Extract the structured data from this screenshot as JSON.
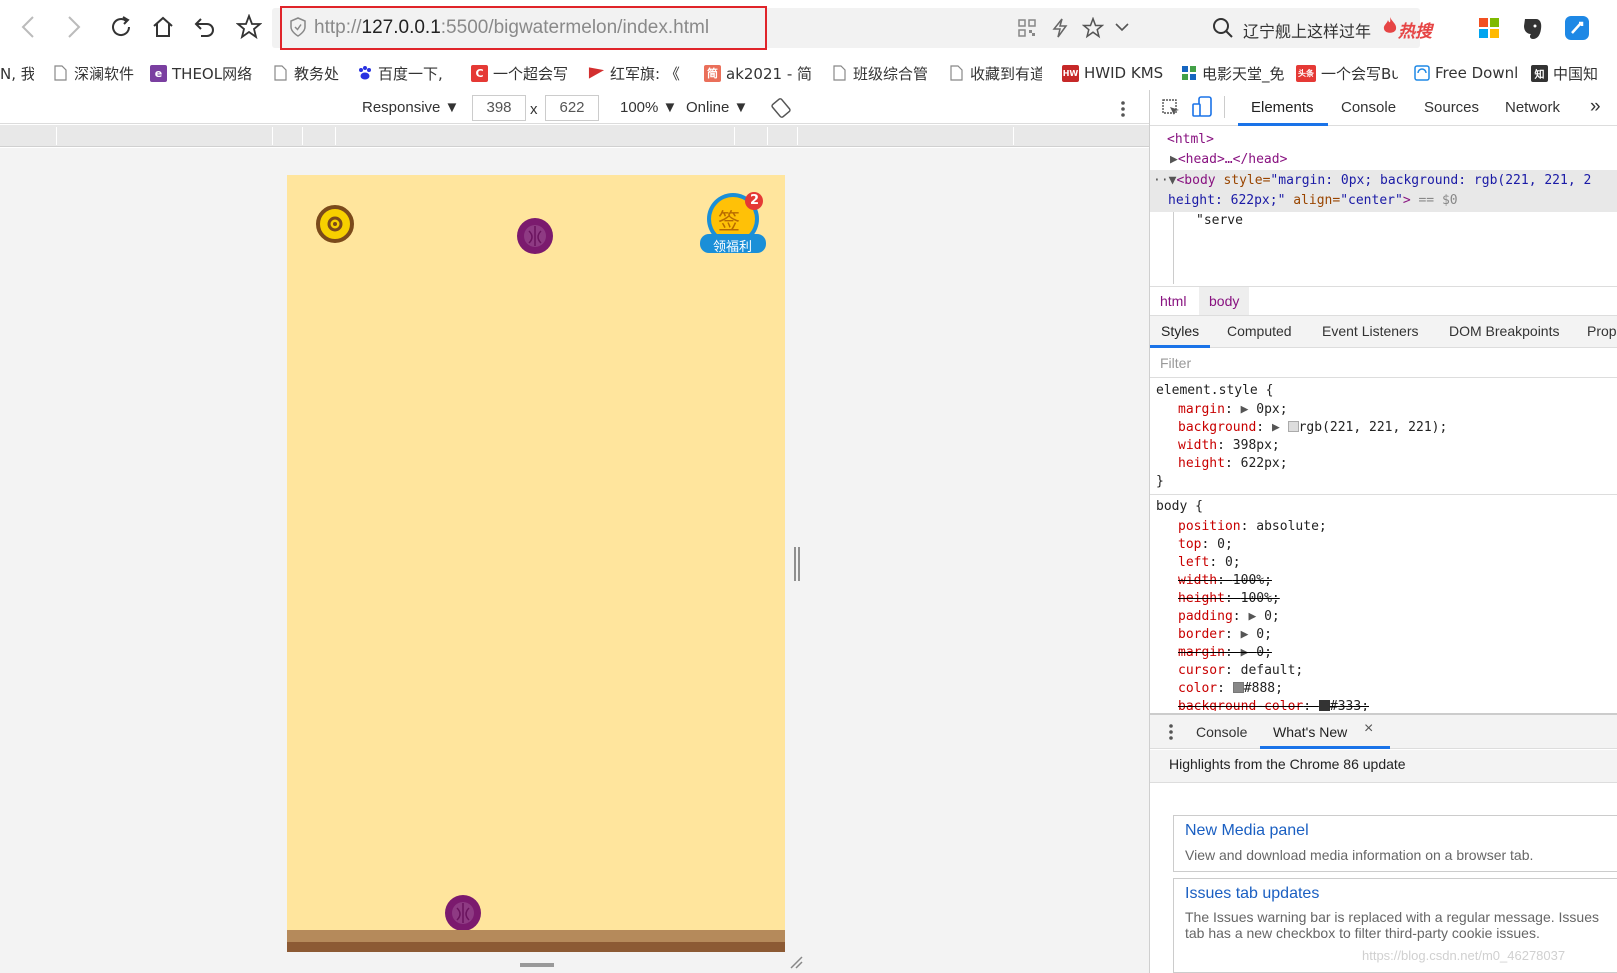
{
  "browser": {
    "url_prefix": "http://",
    "url_host": "127.0.0.1",
    "url_rest": ":5500/bigwatermelon/index.html",
    "search_text": "辽宁舰上这样过年",
    "hot_label": "热搜"
  },
  "bookmarks": [
    {
      "label": "N, 我",
      "fav": ""
    },
    {
      "label": "深澜软件",
      "fav": "page"
    },
    {
      "label": "THEOL网络",
      "fav": "purple"
    },
    {
      "label": "教务处",
      "fav": "page"
    },
    {
      "label": "百度一下,",
      "fav": "paw"
    },
    {
      "label": "一个超会写",
      "fav": "C"
    },
    {
      "label": "红军旗: 《",
      "fav": "flag"
    },
    {
      "label": "ak2021 - 简",
      "fav": "简"
    },
    {
      "label": "班级综合管",
      "fav": "page"
    },
    {
      "label": "收藏到有道",
      "fav": "page"
    },
    {
      "label": "HWID KMS",
      "fav": "red"
    },
    {
      "label": "电影天堂_免",
      "fav": "grid"
    },
    {
      "label": "一个会写Bu",
      "fav": "头条"
    },
    {
      "label": "Free Downl",
      "fav": "refresh"
    },
    {
      "label": "中国知",
      "fav": "知"
    }
  ],
  "device_toolbar": {
    "mode": "Responsive ▼",
    "width": "398",
    "times": "x",
    "height": "622",
    "zoom": "100% ▼",
    "network": "Online ▼"
  },
  "game": {
    "sign_badge_count": "2",
    "sign_char": "签",
    "welfare_label": "领福利"
  },
  "devtools": {
    "tabs": [
      "Elements",
      "Console",
      "Sources",
      "Network"
    ],
    "more": "»",
    "dom": {
      "html_open": "<html>",
      "head": "<head>…</head>",
      "body_tag": "<body",
      "body_style_attr": " style=",
      "body_style_val": "\"margin: 0px; background: rgb(221, 221, 2",
      "body_line2_val": "height: 622px;\"",
      "body_align_attr": " align=",
      "body_align_val": "\"center\"",
      "body_close": ">",
      "body_marker": " == $0",
      "text_node": "\"serve"
    },
    "breadcrumbs": [
      "html",
      "body"
    ],
    "style_tabs": [
      "Styles",
      "Computed",
      "Event Listeners",
      "DOM Breakpoints",
      "Prope"
    ],
    "filter_placeholder": "Filter",
    "element_style": {
      "selector": "element.style {",
      "rules": [
        {
          "prop": "margin",
          "value": "0px;",
          "arrow": true
        },
        {
          "prop": "background",
          "value": "rgb(221, 221, 221);",
          "arrow": true,
          "swatch": "#dddddd"
        },
        {
          "prop": "width",
          "value": "398px;"
        },
        {
          "prop": "height",
          "value": "622px;"
        }
      ],
      "close": "}"
    },
    "body_rule": {
      "selector": "body {",
      "rules": [
        {
          "prop": "position",
          "value": "absolute;"
        },
        {
          "prop": "top",
          "value": "0;"
        },
        {
          "prop": "left",
          "value": "0;"
        },
        {
          "prop": "width",
          "value": "100%;",
          "strike": true
        },
        {
          "prop": "height",
          "value": "100%;",
          "strike": true
        },
        {
          "prop": "padding",
          "value": "0;",
          "arrow": true
        },
        {
          "prop": "border",
          "value": "0;",
          "arrow": true
        },
        {
          "prop": "margin",
          "value": "0;",
          "arrow": true,
          "strike": true
        },
        {
          "prop": "cursor",
          "value": "default;"
        },
        {
          "prop": "color",
          "value": "#888;",
          "swatch": "#888888"
        },
        {
          "prop": "background-color",
          "value": "#333;",
          "swatch": "#333333",
          "strike": true
        }
      ]
    },
    "drawer": {
      "tabs": [
        "Console",
        "What's New"
      ],
      "close": "×",
      "headline": "Highlights from the Chrome 86 update",
      "cards": [
        {
          "title": "New Media panel",
          "body": "View and download media information on a browser tab."
        },
        {
          "title": "Issues tab updates",
          "body": "The Issues warning bar is replaced with a regular message. Issues tab has a new checkbox to filter third-party cookie issues."
        }
      ]
    },
    "watermark": "https://blog.csdn.net/m0_46278037"
  },
  "colors": {
    "game_bg": "#ffe59d",
    "ground_light": "#b58a5b",
    "ground_dark": "#8c5a34",
    "fruit": "#7b1a6e",
    "highlight_box": "#e0242a",
    "devtools_active": "#1a73e8"
  },
  "icons": [
    "back-icon",
    "forward-icon",
    "reload-icon",
    "home-icon",
    "undo-icon",
    "star-icon",
    "shield-icon",
    "qr-icon",
    "bolt-icon",
    "chevron-down-icon",
    "search-icon",
    "fire-icon",
    "windows-icon",
    "evernote-icon",
    "app-icon",
    "inspect-icon",
    "device-icon",
    "kebab-menu-icon",
    "rotate-icon"
  ]
}
